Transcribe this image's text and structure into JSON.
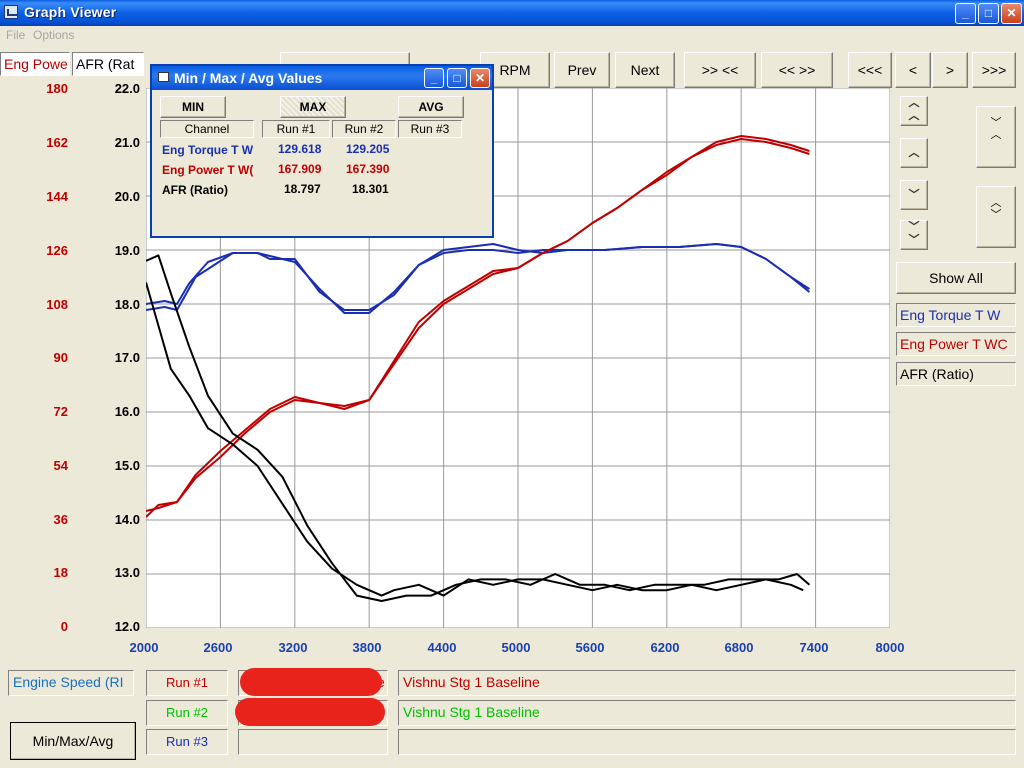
{
  "window": {
    "title": "Graph Viewer",
    "minimize": "_",
    "maximize": "□",
    "close": "✕"
  },
  "menu": {
    "file": "File",
    "options": "Options"
  },
  "toolbar": {
    "channel_boxes": [
      "Eng Powe",
      "AFR (Rat"
    ],
    "rpm": "RPM",
    "prev": "Prev",
    "next": "Next",
    "zoom_in": ">> <<",
    "zoom_out": "<< >>",
    "far_left": "<<<",
    "left": "<",
    "right": ">",
    "far_right": ">>>"
  },
  "right_panel": {
    "show_all": "Show All",
    "legend": [
      {
        "label": "Eng Torque T W",
        "color": "#1a2fb0"
      },
      {
        "label": "Eng Power T WC",
        "color": "#c00000"
      },
      {
        "label": "AFR (Ratio)",
        "color": "#000000"
      }
    ]
  },
  "dialog": {
    "title": "Min / Max / Avg Values",
    "tabs": [
      "MIN",
      "MAX",
      "AVG"
    ],
    "selected_tab": "MAX",
    "headers": [
      "Channel",
      "Run #1",
      "Run #2",
      "Run #3"
    ],
    "rows": [
      {
        "channel": "Eng Torque T W",
        "run1": "129.618",
        "run2": "129.205",
        "run3": "",
        "color": "#1a2fb0"
      },
      {
        "channel": "Eng Power T W(",
        "run1": "167.909",
        "run2": "167.390",
        "run3": "",
        "color": "#c00000"
      },
      {
        "channel": "AFR (Ratio)",
        "run1": "18.797",
        "run2": "18.301",
        "run3": "",
        "color": "#000000"
      }
    ]
  },
  "footer": {
    "x_channel": "Engine Speed (RI",
    "runs": [
      {
        "label": "Run #1",
        "name": "Vishnu Stg 1 Baseline",
        "color": "#c00000",
        "file_suffix": "e"
      },
      {
        "label": "Run #2",
        "name": "Vishnu Stg 1 Baseline",
        "color": "#00c000",
        "file_suffix": ""
      },
      {
        "label": "Run #3",
        "name": "",
        "color": "#1a2fb0",
        "file_suffix": ""
      }
    ],
    "minmax_button": "Min/Max/Avg"
  },
  "chart_data": {
    "type": "line",
    "x_label": "Engine Speed (RI",
    "x_ticks": [
      "2000",
      "2600",
      "3200",
      "3800",
      "4400",
      "5000",
      "5600",
      "6200",
      "6800",
      "7400",
      "8000"
    ],
    "xlim": [
      2000,
      8000
    ],
    "y_left_ticks": [
      "180",
      "162",
      "144",
      "126",
      "108",
      "90",
      "72",
      "54",
      "36",
      "18",
      "0"
    ],
    "y_left_lim": [
      0,
      180
    ],
    "y_right_ticks": [
      "22.0",
      "21.0",
      "20.0",
      "19.0",
      "18.0",
      "17.0",
      "16.0",
      "15.0",
      "14.0",
      "13.0",
      "12.0"
    ],
    "y_right_lim": [
      12,
      22
    ],
    "grid": true,
    "series": [
      {
        "name": "Eng Torque T W",
        "run": "Run #1",
        "color": "#1a2fb0",
        "axis": "left",
        "x": [
          2000,
          2150,
          2250,
          2350,
          2500,
          2700,
          2900,
          3000,
          3200,
          3400,
          3600,
          3800,
          4000,
          4200,
          4400,
          4600,
          4800,
          5000,
          5200,
          5400,
          5700,
          6000,
          6300,
          6600,
          6800,
          7000,
          7200,
          7350
        ],
        "y": [
          108,
          109,
          108,
          115,
          122,
          125,
          125,
          124,
          122,
          113,
          105,
          105,
          112,
          121,
          126,
          127,
          128,
          126,
          125,
          126,
          126,
          127,
          127,
          128,
          127,
          123,
          117,
          113
        ]
      },
      {
        "name": "Eng Torque T W",
        "run": "Run #2",
        "color": "#1a2fb0",
        "axis": "left",
        "x": [
          2000,
          2150,
          2250,
          2400,
          2550,
          2700,
          2900,
          3000,
          3200,
          3400,
          3600,
          3800,
          4000,
          4200,
          4400,
          4600,
          4800,
          5000,
          5200,
          5400,
          5700,
          6000,
          6300,
          6600,
          6800,
          7000,
          7200,
          7350
        ],
        "y": [
          106,
          107,
          106,
          117,
          121,
          125,
          125,
          123,
          123,
          112,
          106,
          106,
          111,
          121,
          125,
          126,
          126,
          125,
          126,
          126,
          126,
          127,
          127,
          128,
          127,
          123,
          117,
          112
        ]
      },
      {
        "name": "Eng Power T WC",
        "run": "Run #1",
        "color": "#c00000",
        "axis": "left",
        "x": [
          2000,
          2100,
          2250,
          2400,
          2600,
          2800,
          3000,
          3200,
          3400,
          3600,
          3800,
          4000,
          4200,
          4400,
          4600,
          4800,
          5000,
          5200,
          5400,
          5600,
          5800,
          6000,
          6200,
          6400,
          6600,
          6800,
          7000,
          7200,
          7350
        ],
        "y": [
          37,
          41,
          42,
          51,
          59,
          66,
          73,
          77,
          75,
          74,
          76,
          89,
          102,
          109,
          114,
          119,
          120,
          125,
          129,
          135,
          140,
          146,
          151,
          157,
          161,
          163,
          162,
          160,
          158
        ]
      },
      {
        "name": "Eng Power T WC",
        "run": "Run #2",
        "color": "#c00000",
        "axis": "left",
        "x": [
          2000,
          2100,
          2250,
          2400,
          2600,
          2800,
          3000,
          3200,
          3400,
          3600,
          3800,
          4000,
          4200,
          4400,
          4600,
          4800,
          5000,
          5200,
          5400,
          5600,
          5800,
          6000,
          6200,
          6400,
          6600,
          6800,
          7000,
          7200,
          7350
        ],
        "y": [
          39,
          40,
          42,
          50,
          57,
          65,
          72,
          76,
          75,
          73,
          76,
          88,
          100,
          108,
          113,
          118,
          120,
          125,
          129,
          135,
          140,
          146,
          152,
          157,
          162,
          164,
          163,
          161,
          159
        ]
      },
      {
        "name": "AFR (Ratio)",
        "run": "Run #1",
        "color": "#000000",
        "axis": "right",
        "x": [
          2000,
          2100,
          2200,
          2350,
          2500,
          2700,
          2900,
          3100,
          3300,
          3500,
          3700,
          3900,
          4000,
          4200,
          4400,
          4600,
          4800,
          5000,
          5200,
          5400,
          5600,
          5800,
          6000,
          6200,
          6400,
          6600,
          6800,
          7000,
          7200,
          7300
        ],
        "y": [
          18.4,
          17.6,
          16.8,
          16.3,
          15.7,
          15.4,
          15.0,
          14.3,
          13.6,
          13.1,
          12.8,
          12.6,
          12.7,
          12.8,
          12.6,
          12.9,
          12.8,
          12.9,
          12.9,
          12.8,
          12.7,
          12.8,
          12.7,
          12.7,
          12.8,
          12.7,
          12.8,
          12.9,
          12.8,
          12.7
        ]
      },
      {
        "name": "AFR (Ratio)",
        "run": "Run #2",
        "color": "#000000",
        "axis": "right",
        "x": [
          2000,
          2100,
          2200,
          2350,
          2500,
          2700,
          2900,
          3100,
          3300,
          3500,
          3700,
          3900,
          4100,
          4300,
          4500,
          4700,
          4900,
          5100,
          5300,
          5500,
          5700,
          5900,
          6100,
          6300,
          6500,
          6700,
          6900,
          7100,
          7250,
          7350
        ],
        "y": [
          18.8,
          18.9,
          18.2,
          17.2,
          16.3,
          15.6,
          15.3,
          14.8,
          13.9,
          13.2,
          12.6,
          12.5,
          12.6,
          12.6,
          12.8,
          12.9,
          12.9,
          12.8,
          13.0,
          12.8,
          12.8,
          12.7,
          12.8,
          12.8,
          12.8,
          12.9,
          12.9,
          12.9,
          13.0,
          12.8
        ]
      }
    ]
  }
}
